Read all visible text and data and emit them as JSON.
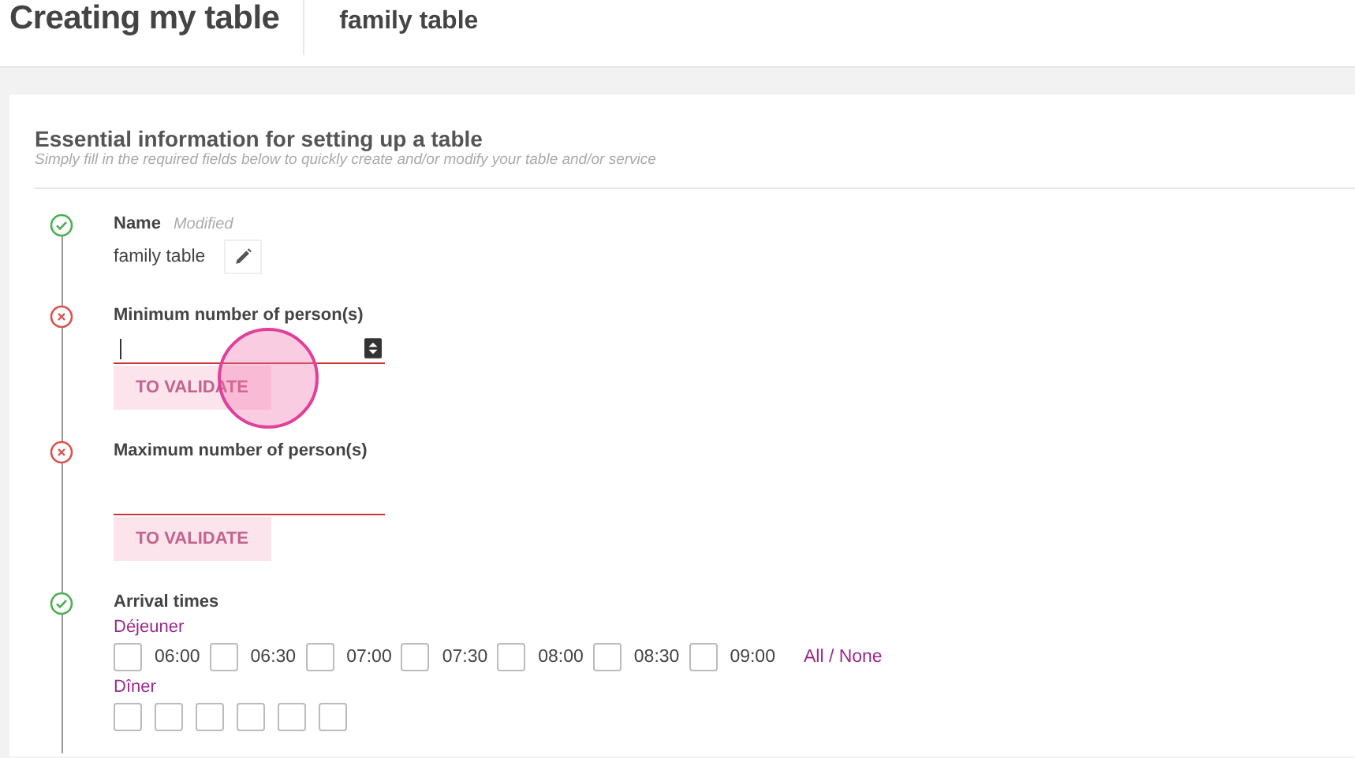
{
  "header": {
    "title": "Creating my table",
    "name_value": "family table"
  },
  "card": {
    "title": "Essential information for setting up a table",
    "subtitle": "Simply fill in the required fields below to quickly create and/or modify your table and/or service"
  },
  "steps": [
    {
      "kind": "text",
      "valid": true,
      "label": "Name",
      "note": "Modified",
      "value": "family table"
    },
    {
      "kind": "number",
      "valid": false,
      "label": "Minimum number of person(s)",
      "focused": true,
      "button": "TO VALIDATE"
    },
    {
      "kind": "number",
      "valid": false,
      "label": "Maximum number of person(s)",
      "focused": false,
      "button": "TO VALIDATE"
    },
    {
      "kind": "times",
      "valid": true,
      "label": "Arrival times",
      "groups": [
        {
          "name": "Déjeuner",
          "action": "All / None",
          "slots": [
            {
              "time": "06:00",
              "checked": false
            },
            {
              "time": "06:30",
              "checked": false
            },
            {
              "time": "07:00",
              "checked": false
            },
            {
              "time": "07:30",
              "checked": false
            },
            {
              "time": "08:00",
              "checked": false
            },
            {
              "time": "08:30",
              "checked": false
            },
            {
              "time": "09:00",
              "checked": false
            }
          ]
        },
        {
          "name": "Dîner",
          "slots": [
            {
              "checked": false
            },
            {
              "checked": false
            },
            {
              "checked": false
            },
            {
              "checked": false
            },
            {
              "checked": false
            },
            {
              "checked": false
            }
          ]
        }
      ]
    }
  ],
  "touch_indicator": {
    "visible": true
  }
}
